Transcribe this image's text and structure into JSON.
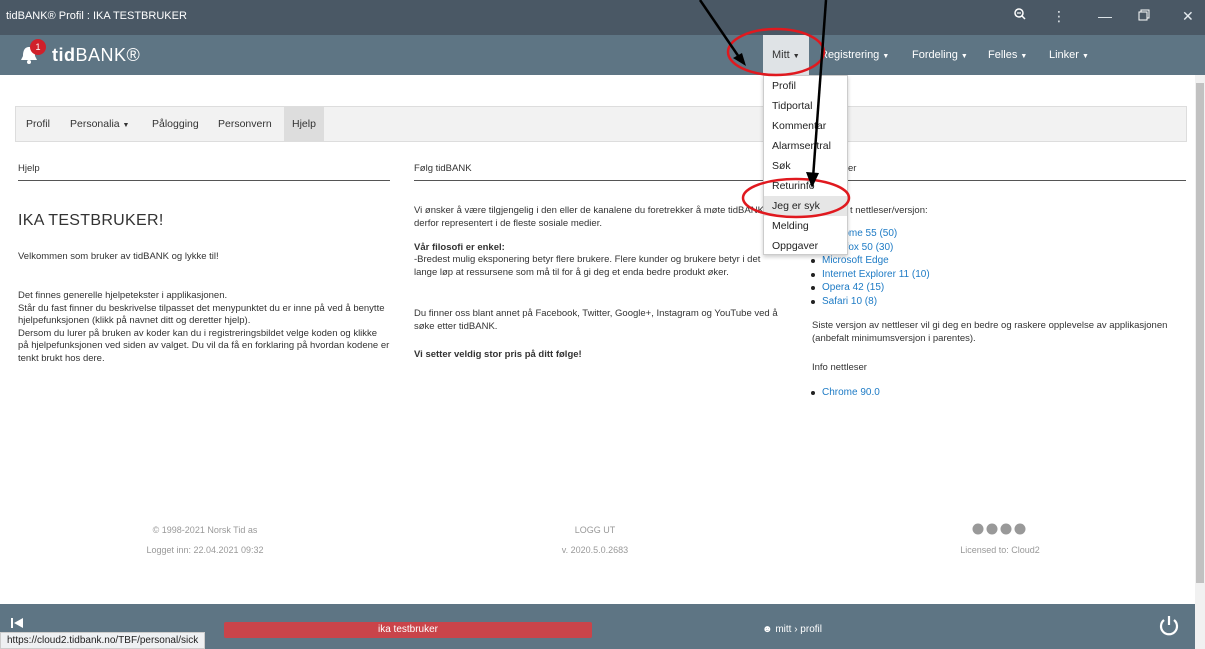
{
  "window": {
    "title": "tidBANK® Profil : IKA TESTBRUKER"
  },
  "app": {
    "notification_count": "1",
    "logo_bold": "tid",
    "logo_rest": "BANK®"
  },
  "nav": {
    "items": [
      {
        "label": "Mitt",
        "chevron": "⌄"
      },
      {
        "label": "Registrering",
        "chevron": "⌄"
      },
      {
        "label": "Fordeling",
        "chevron": "⌄"
      },
      {
        "label": "Felles",
        "chevron": "⌄"
      },
      {
        "label": "Linker",
        "chevron": "⌄"
      }
    ],
    "dropdown": [
      "Profil",
      "Tidportal",
      "Kommentar",
      "Alarmsentral",
      "Søk",
      "Returinfo",
      "Jeg er syk",
      "Melding",
      "Oppgaver"
    ]
  },
  "subtabs": [
    "Profil",
    "Personalia",
    "Pålogging",
    "Personvern",
    "Hjelp"
  ],
  "columns": {
    "left": {
      "header": "Hjelp",
      "title": "IKA TESTBRUKER!",
      "welcome": "Velkommen som bruker av tidBANK og lykke til!",
      "p1": "Det finnes generelle hjelpetekster i applikasjonen.",
      "p2": "Står du fast finner du beskrivelse tilpasset det menypunktet du er inne på ved å benytte hjelpefunksjonen (klikk på navnet ditt og deretter hjelp).",
      "p3": "Dersom du lurer på bruken av koder kan du i registreringsbildet velge koden og klikke på hjelpefunksjonen ved siden av valget. Du vil da få en forklaring på hvordan kodene er tenkt brukt hos dere."
    },
    "middle": {
      "header": "Følg tidBANK",
      "p1": "Vi ønsker å være tilgjengelig i den eller de kanalene du foretrekker å møte tidBANK er derfor representert i de fleste sosiale medier.",
      "philosophy_title": "Vår filosofi er enkel:",
      "philosophy": "-Bredest mulig eksponering betyr flere brukere. Flere kunder og brukere betyr i det lange løp at ressursene som må til for å gi deg et enda bedre produkt øker.",
      "p3": "Du finner oss blant annet på Facebook, Twitter, Google+, Instagram og YouTube ved å søke etter tidBANK.",
      "closing": "Vi setter veldig stor pris på ditt følge!"
    },
    "right": {
      "header_visible": "er",
      "intro_visible": "t nettleser/versjon:",
      "browsers": [
        "Chrome 55 (50)",
        "Firefox 50 (30)",
        "Microsoft Edge",
        "Internet Explorer 11 (10)",
        "Opera 42 (15)",
        "Safari 10 (8)"
      ],
      "browser_visible": [
        "rome 55 (50)",
        "efox 50 (30)",
        "Microsoft Edge",
        "Internet Explorer 11 (10)",
        "Opera 42 (15)",
        "Safari 10 (8)"
      ],
      "latest_note": "Siste versjon av nettleser vil gi deg en bedre og raskere opplevelse av applikasjonen (anbefalt minimumsversjon i parentes).",
      "info_title": "Info nettleser",
      "current_browser": "Chrome 90.0"
    }
  },
  "footer": {
    "copyright": "© 1998-2021 Norsk Tid as",
    "logged_in": "Logget inn: 22.04.2021 09:32",
    "logout": "LOGG UT",
    "version": "v. 2020.5.0.2683",
    "license": "Licensed to: Cloud2"
  },
  "bottom": {
    "user": "ika testbruker",
    "breadcrumb": "mitt › profil",
    "url": "https://cloud2.tidbank.no/TBF/personal/sick"
  },
  "colors": {
    "titlebar": "#4a5865",
    "navbar": "#5e7584",
    "badge": "#d0202a",
    "link": "#1e7bc5",
    "annotation": "#e0191f"
  }
}
